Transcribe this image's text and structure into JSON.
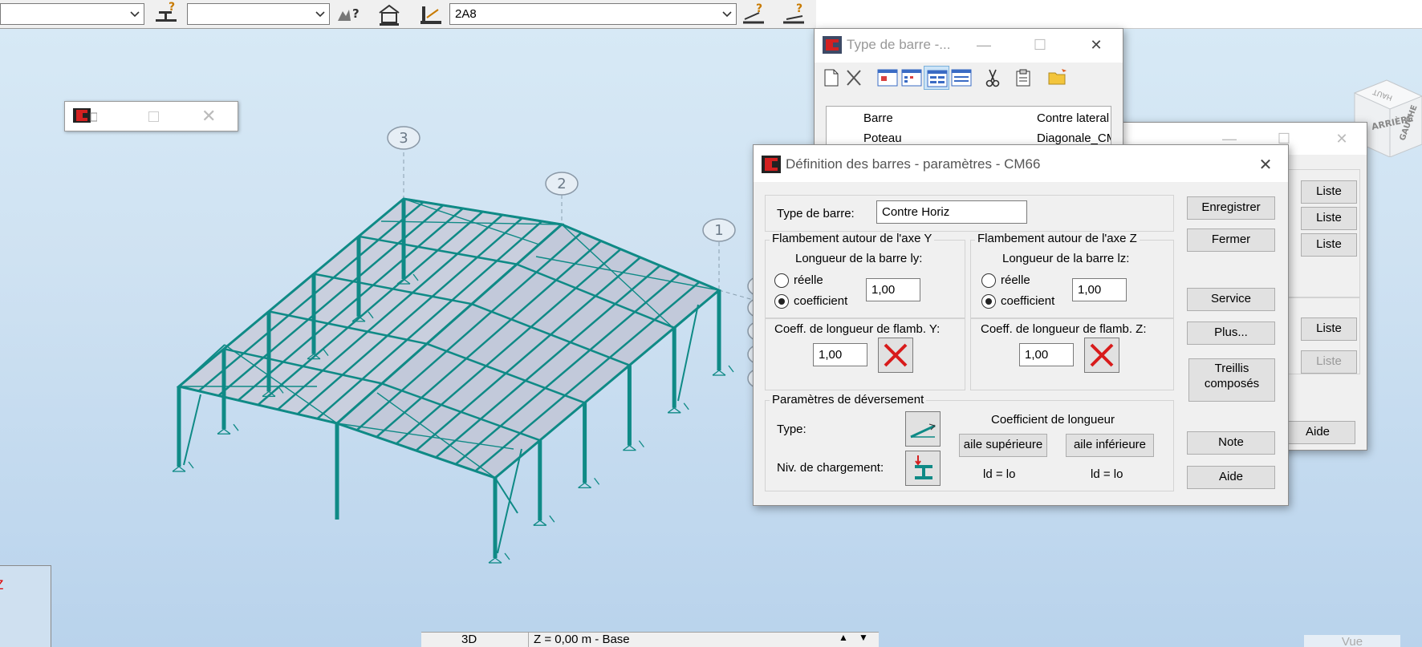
{
  "toolbar": {
    "combo1_value": "",
    "combo2_value": "",
    "combo3_value": "2A8"
  },
  "view": {
    "axis_labels": [
      "3",
      "2",
      "1"
    ],
    "viewcube_labels": [
      "ARRIÈRE",
      "GAUCHE",
      "HAUT"
    ],
    "left_axis_mark": "Z",
    "status_mode": "3D",
    "status_level": "Z = 0,00 m - Base",
    "status_right": "Vue"
  },
  "type_window": {
    "title": "Type de barre -...",
    "rows": [
      {
        "name": "Barre",
        "value": "Contre lateral"
      },
      {
        "name": "Poteau",
        "value": "Diagonale_CM"
      }
    ]
  },
  "back_window": {
    "buttons": [
      "Liste",
      "Liste",
      "Liste",
      "Liste",
      "Liste"
    ],
    "help": "Aide"
  },
  "dialog": {
    "title": "Définition des barres - paramètres - CM66",
    "type_label": "Type de barre:",
    "type_value": "Contre Horiz",
    "flamb_y": {
      "group": "Flambement autour de l'axe Y",
      "length_label": "Longueur de la barre ly:",
      "radio_real": "réelle",
      "radio_coef": "coefficient",
      "coef_value": "1,00",
      "coef_label": "Coeff. de longueur de flamb. Y:",
      "coef_flamb_value": "1,00"
    },
    "flamb_z": {
      "group": "Flambement autour de l'axe Z",
      "length_label": "Longueur de la barre lz:",
      "radio_real": "réelle",
      "radio_coef": "coefficient",
      "coef_value": "1,00",
      "coef_label": "Coeff. de longueur de flamb. Z:",
      "coef_flamb_value": "1,00"
    },
    "deversement": {
      "group": "Paramètres de déversement",
      "type_label": "Type:",
      "load_label": "Niv. de chargement:",
      "coef_title": "Coefficient de longueur",
      "upper_btn": "aile supérieure",
      "lower_btn": "aile inférieure",
      "upper_formula": "ld =  lo",
      "lower_formula": "ld =  lo"
    },
    "buttons": {
      "save": "Enregistrer",
      "close": "Fermer",
      "service": "Service",
      "more": "Plus...",
      "treillis_line1": "Treillis",
      "treillis_line2": "composés",
      "note": "Note",
      "help": "Aide"
    }
  },
  "colors": {
    "steel": "#0f8a86",
    "roof": "#c9cfde",
    "redX": "#d81b1b"
  }
}
